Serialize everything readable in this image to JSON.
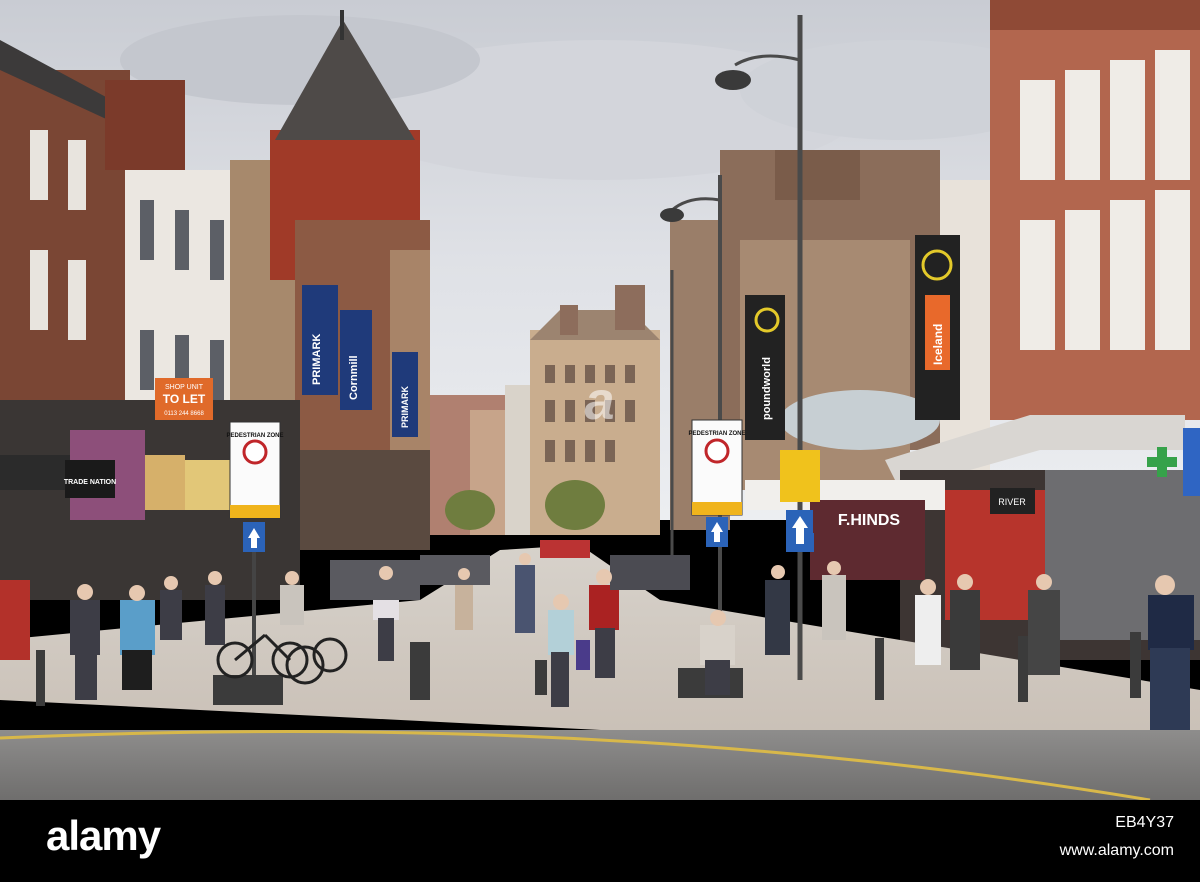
{
  "signs": {
    "shop_let_top": "SHOP UNIT",
    "shop_let_main": "TO LET",
    "shop_let_phone": "0113 244 8668",
    "trade_nation": "TRADE NATION",
    "pedestrian_zone_1": "PEDESTRIAN ZONE",
    "pedestrian_zone_2": "PEDESTRIAN ZONE",
    "primark_banner_1": "PRIMARK",
    "primark_banner_2": "PRIMARK",
    "cornmill_banner": "Cornmill",
    "poundworld_banner": "poundworld",
    "iceland_banner": "Iceland",
    "fhinds": "F.HINDS",
    "river_island": "RIVER"
  },
  "watermark": {
    "center_text": "a"
  },
  "footer": {
    "logo": "alamy",
    "image_id": "EB4Y37",
    "url": "www.alamy.com"
  }
}
